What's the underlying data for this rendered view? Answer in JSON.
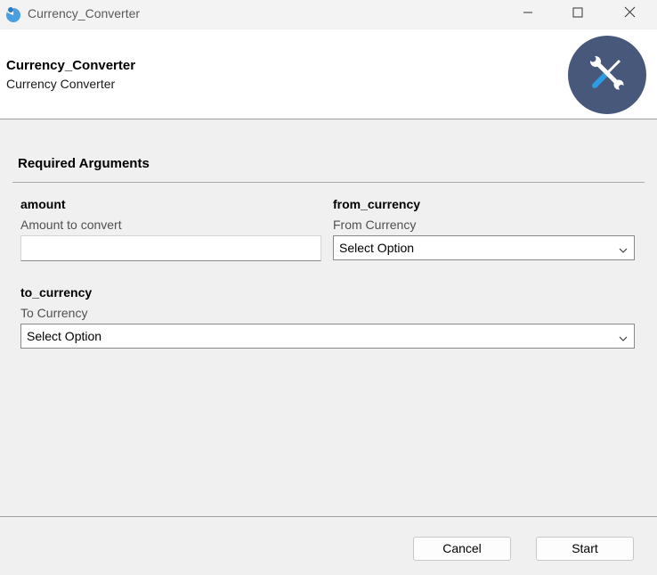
{
  "window": {
    "title": "Currency_Converter",
    "icon": "gooey-app-icon",
    "controls": [
      "minimize-icon",
      "maximize-icon",
      "close-icon"
    ]
  },
  "header": {
    "program_name": "Currency_Converter",
    "program_description": "Currency Converter",
    "logo_icon": "tools-icon",
    "logo_color": "#47587b"
  },
  "section": {
    "title": "Required Arguments"
  },
  "arguments": {
    "amount": {
      "name": "amount",
      "help": "Amount to convert",
      "value": ""
    },
    "from_currency": {
      "name": "from_currency",
      "help": "From Currency",
      "selected": "Select Option"
    },
    "to_currency": {
      "name": "to_currency",
      "help": "To Currency",
      "selected": "Select Option"
    }
  },
  "buttons": {
    "cancel": "Cancel",
    "start": "Start"
  }
}
